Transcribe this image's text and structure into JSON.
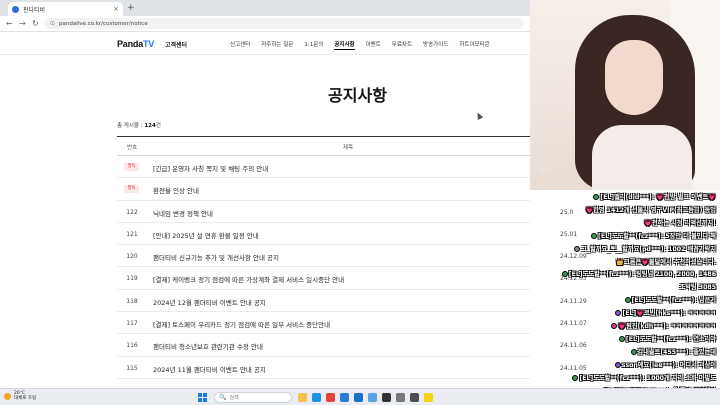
{
  "browser": {
    "tab_title": "판다티비",
    "tab_close": "×",
    "new_tab": "+",
    "back": "←",
    "forward": "→",
    "reload": "↻",
    "url": "pandalive.co.kr/customer/notice"
  },
  "site": {
    "logo_main": "Panda",
    "logo_tv": "TV",
    "logo_sub": "고객센터",
    "nav": [
      "신고센터",
      "자주하는 질문",
      "1:1문의",
      "공지사항",
      "이벤트",
      "무료차트",
      "방송가이드",
      "하트이모티콘"
    ],
    "active_nav": "공지사항"
  },
  "page": {
    "title": "공지사항",
    "total_label": "총 게시물 :",
    "total_count": "124",
    "total_unit": "건",
    "headers": {
      "no": "번호",
      "subject": "제목"
    },
    "rows": [
      {
        "no": "필독",
        "pinned": true,
        "title": "[긴급] 운영자 사칭 쪽지 및 채팅 주의 안내",
        "date": ""
      },
      {
        "no": "필독",
        "pinned": true,
        "title": "환전율 인상 안내",
        "date": ""
      },
      {
        "no": "122",
        "pinned": false,
        "title": "닉네임 변경 정책 안내",
        "date": "25.0"
      },
      {
        "no": "121",
        "pinned": false,
        "title": "[안내] 2025년 설 연휴 환불 일정 안내",
        "date": "25.01"
      },
      {
        "no": "120",
        "pinned": false,
        "title": "팬더티비 신규기능 추가 및 개선사항 안내 공지",
        "date": "24.12.09"
      },
      {
        "no": "119",
        "pinned": false,
        "title": "[결제] 케이뱅크 정기 점검에 따른 가상계좌 결제 서비스 일시중단 안내",
        "date": "24.12.03"
      },
      {
        "no": "118",
        "pinned": false,
        "title": "2024년 12월 팬더티비 이벤트 안내 공지",
        "date": "24.11.29"
      },
      {
        "no": "117",
        "pinned": false,
        "title": "[결제] 토스페이 우리카드 정기 점검에 따른 일부 서비스 중단안내",
        "date": "24.11.07"
      },
      {
        "no": "116",
        "pinned": false,
        "title": "팬더티비 청소년보호 관련기관 수정 안내",
        "date": "24.11.06"
      },
      {
        "no": "115",
        "pinned": false,
        "title": "2024년 11월 팬더티비 이벤트 안내 공지",
        "date": "24.11.05"
      }
    ]
  },
  "chat": [
    {
      "text": "[EL]앨리(dld***): 💗천방 벌크 이벤트💗",
      "badge": "#3a9a55"
    },
    {
      "text": "💗한명 1412개 선물시 영구VIP(최고등급) 등업",
      "badge": ""
    },
    {
      "text": "💗천하는 시청 리액션까지!",
      "badge": ""
    },
    {
      "text": "[EL]도도할**(fcz***): 5장만 더 불인다 해",
      "badge": "#3a9a55"
    },
    {
      "text": "그_할까요_뽀__할까요(pd***): 1002 배꼽가락지",
      "badge": "#888888"
    },
    {
      "text": "👑크론큰💗물달에서 추천하셨습니다.",
      "badge": ""
    },
    {
      "text": "[EL]도도할**(fcz***): 팅팅넘 2100, 2000, 1486",
      "badge": "#3a9a55"
    },
    {
      "text": "조박팅 3085",
      "badge": ""
    },
    {
      "text": "[EL]도도할**(fcz***): 남은거",
      "badge": "#3a9a55"
    },
    {
      "text": "[EL]💗로빈(hks***): ㅋㅋㅋㅋㅋ",
      "badge": "#8a4fd6"
    },
    {
      "text": "💗원진(kdh***): ㅋㅋㅋㅋㅋㅋㅋㅋ",
      "badge": "#d63f8c"
    },
    {
      "text": "[EL]도도할**(fcz***): 연소리야",
      "badge": "#3a9a55"
    },
    {
      "text": "감내솔트(455***): 좋았는데",
      "badge": "#3a9a55"
    },
    {
      "text": "sson에요(lee***): 어디서 괴상이",
      "badge": "#8a4fd6"
    },
    {
      "text": "[EL]도도할**(fcz***): 1000개 자리 소화 아밭도",
      "badge": "#3a9a55"
    },
    {
      "text": "[EL]💗2오오(542***): 약통이 출볼했다",
      "badge": "#d63f8c"
    }
  ],
  "taskbar": {
    "temp": "26°C",
    "weather": "대체로 흐림",
    "search_placeholder": "검색",
    "search_icon": "🔍",
    "apps": [
      "file-explorer",
      "edge",
      "chrome",
      "store",
      "mail",
      "photos",
      "terminal",
      "settings",
      "notepad",
      "kakaotalk"
    ]
  }
}
